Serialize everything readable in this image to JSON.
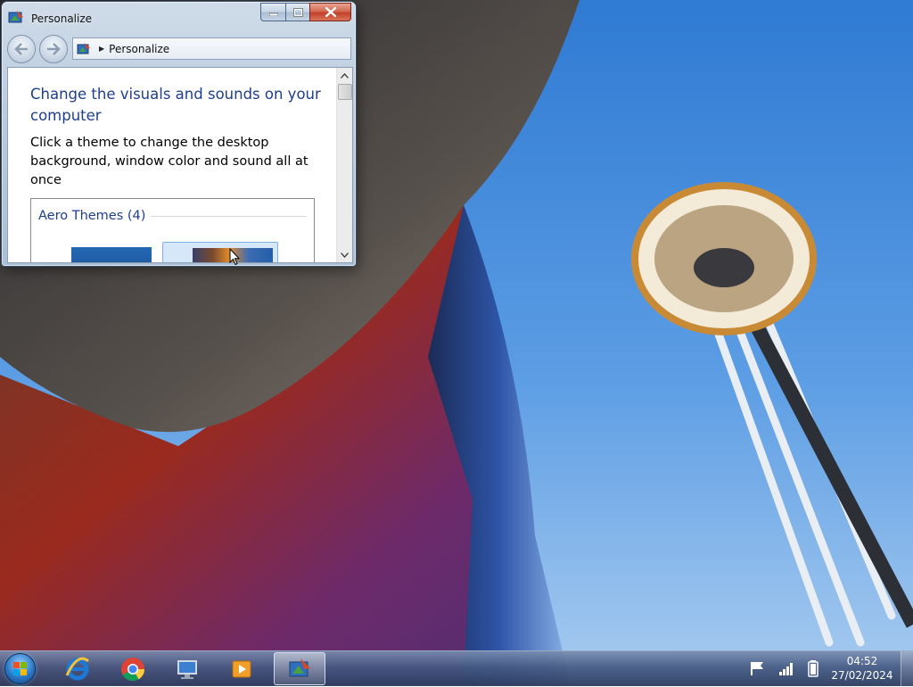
{
  "window": {
    "title": "Personalize",
    "address_crumb": "Personalize",
    "heading": "Change the visuals and sounds on your computer",
    "description": "Click a theme to change the desktop background, window color and sound all at once",
    "group_title": "Aero Themes (4)"
  },
  "taskbar": {
    "pinned": [
      "internet-explorer",
      "google-chrome",
      "remote-desktop",
      "media-player"
    ],
    "active_app": "personalize",
    "clock_time": "04:52",
    "clock_date": "27/02/2024"
  },
  "colors": {
    "heading": "#1e3e8f",
    "sky": "#3f86d8",
    "close_button": "#c2402a"
  }
}
